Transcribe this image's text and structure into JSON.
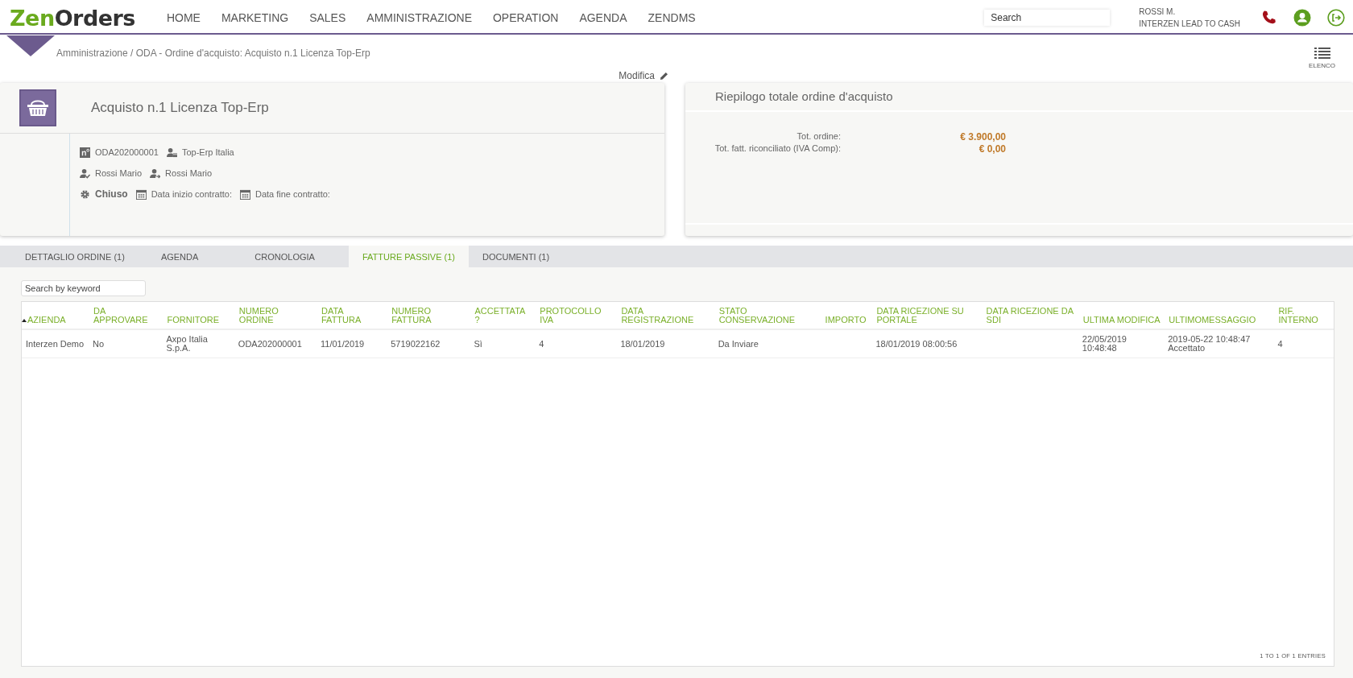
{
  "header": {
    "logo": {
      "part_1": "Zen",
      "part_2": "Orders"
    },
    "menu": [
      {
        "label": "HOME"
      },
      {
        "label": "MARKETING"
      },
      {
        "label": "SALES"
      },
      {
        "label": "AMMINISTRAZIONE"
      },
      {
        "label": "OPERATION"
      },
      {
        "label": "AGENDA"
      },
      {
        "label": "ZENDMS"
      }
    ],
    "search": {
      "placeholder": "Search"
    },
    "user": {
      "name": "ROSSI M.",
      "company": "INTERZEN LEAD TO CASH"
    }
  },
  "breadcrumb": "Amministrazione / ODA - Ordine d'acquisto: Acquisto n.1 Licenza Top-Erp",
  "edit_link": "Modifica",
  "list_button": "ELENCO",
  "order": {
    "title": "Acquisto n.1 Licenza Top-Erp",
    "detail_rows": [
      [
        {
          "kind": "number",
          "text": "ODA202000001"
        },
        {
          "kind": "supplier",
          "text": "Top-Erp Italia"
        }
      ],
      [
        {
          "kind": "approver",
          "text": "Rossi Mario"
        },
        {
          "kind": "assignee",
          "text": "Rossi Mario"
        }
      ],
      [
        {
          "kind": "status",
          "text": "Chiuso"
        },
        {
          "kind": "date",
          "text": "Data inizio contratto:"
        },
        {
          "kind": "date",
          "text": "Data fine contratto:"
        }
      ]
    ]
  },
  "summary": {
    "title": "Riepilogo totale ordine d'acquisto",
    "rows": [
      {
        "label": "Tot. ordine:",
        "value": "€ 3.900,00"
      },
      {
        "label": "Tot. fatt. riconciliato (IVA Comp):",
        "value": "€ 0,00"
      }
    ]
  },
  "tabs": [
    {
      "label": "DETTAGLIO ORDINE (1)",
      "selected": false
    },
    {
      "label": "AGENDA",
      "selected": false
    },
    {
      "label": "CRONOLOGIA",
      "selected": false
    },
    {
      "label": "FATTURE PASSIVE (1)",
      "selected": true
    },
    {
      "label": "DOCUMENTI (1)",
      "selected": false
    }
  ],
  "table": {
    "search": {
      "placeholder": "Search by keyword"
    },
    "columns": [
      {
        "label": "AZIENDA",
        "sorted": true
      },
      {
        "label": "DA APPROVARE",
        "sorted": false
      },
      {
        "label": "FORNITORE",
        "sorted": false
      },
      {
        "label": "NUMERO ORDINE",
        "sorted": false
      },
      {
        "label": "DATA FATTURA",
        "sorted": false
      },
      {
        "label": "NUMERO FATTURA",
        "sorted": false
      },
      {
        "label": "ACCETTATA ?",
        "sorted": false
      },
      {
        "label": "PROTOCOLLO IVA",
        "sorted": false
      },
      {
        "label": "DATA REGISTRAZIONE",
        "sorted": false
      },
      {
        "label": "STATO CONSERVAZIONE",
        "sorted": false
      },
      {
        "label": "IMPORTO",
        "sorted": false
      },
      {
        "label": "DATA RICEZIONE SU PORTALE",
        "sorted": false
      },
      {
        "label": "DATA RICEZIONE DA SDI",
        "sorted": false
      },
      {
        "label": "ULTIMA MODIFICA",
        "sorted": false
      },
      {
        "label": "ULTIMOMESSAGGIO",
        "sorted": false
      },
      {
        "label": "RIF. INTERNO",
        "sorted": false
      }
    ],
    "rows": [
      [
        "Interzen Demo",
        "No",
        "Axpo Italia S.p.A.",
        "ODA202000001",
        "11/01/2019",
        "5719022162",
        "Sì",
        "4",
        "18/01/2019",
        "Da Inviare",
        "",
        "18/01/2019 08:00:56",
        "",
        "22/05/2019 10:48:48",
        "2019-05-22 10:48:47 Accettato",
        "4"
      ]
    ],
    "footer": "1 TO 1 OF 1 ENTRIES"
  }
}
